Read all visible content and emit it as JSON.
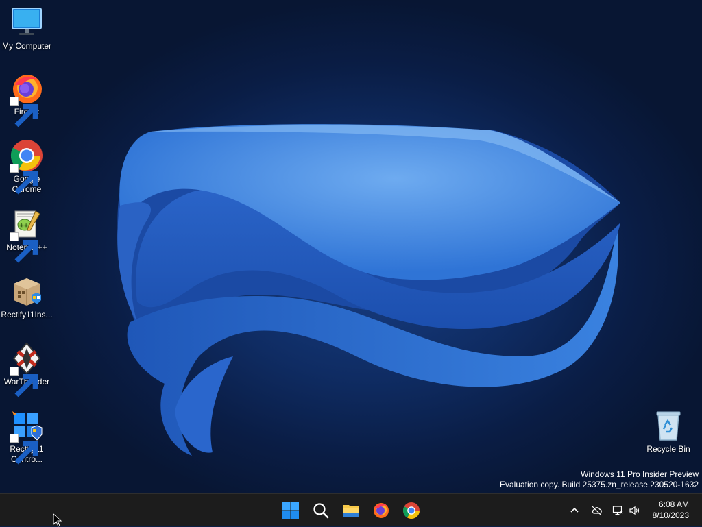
{
  "desktop": {
    "icons": [
      {
        "label": "My Computer",
        "icon": "monitor-icon",
        "shortcut": false
      },
      {
        "label": "Firefox",
        "icon": "firefox-icon",
        "shortcut": true
      },
      {
        "label": "Google Chrome",
        "icon": "chrome-icon",
        "shortcut": true
      },
      {
        "label": "Notepad++",
        "icon": "notepadpp-icon",
        "shortcut": true
      },
      {
        "label": "Rectify11Ins...",
        "icon": "installer-box-icon",
        "shortcut": false
      },
      {
        "label": "WarThunder",
        "icon": "warthunder-icon",
        "shortcut": true
      },
      {
        "label": "Rectify11 Contro...",
        "icon": "control-center-icon",
        "shortcut": true
      },
      {
        "label": "Recycle Bin",
        "icon": "recycle-bin-icon",
        "shortcut": false
      }
    ]
  },
  "watermark": {
    "line1": "Windows 11 Pro Insider Preview",
    "line2": "Evaluation copy. Build 25375.zn_release.230520-1632"
  },
  "taskbar": {
    "apps": [
      {
        "name": "start",
        "icon": "windows-start-icon"
      },
      {
        "name": "search",
        "icon": "search-icon"
      },
      {
        "name": "file-explorer",
        "icon": "folder-icon"
      },
      {
        "name": "firefox",
        "icon": "firefox-icon"
      },
      {
        "name": "chrome",
        "icon": "chrome-icon"
      }
    ],
    "tray": {
      "icons": [
        "chevron-up-icon",
        "onedrive-offline-icon",
        "network-icon",
        "volume-icon"
      ],
      "time": "6:08 AM",
      "date": "8/10/2023"
    }
  },
  "colors": {
    "accent": "#2b6fd6",
    "taskbar_bg": "#1c1c1c",
    "wallpaper_dark": "#0a1d45"
  }
}
